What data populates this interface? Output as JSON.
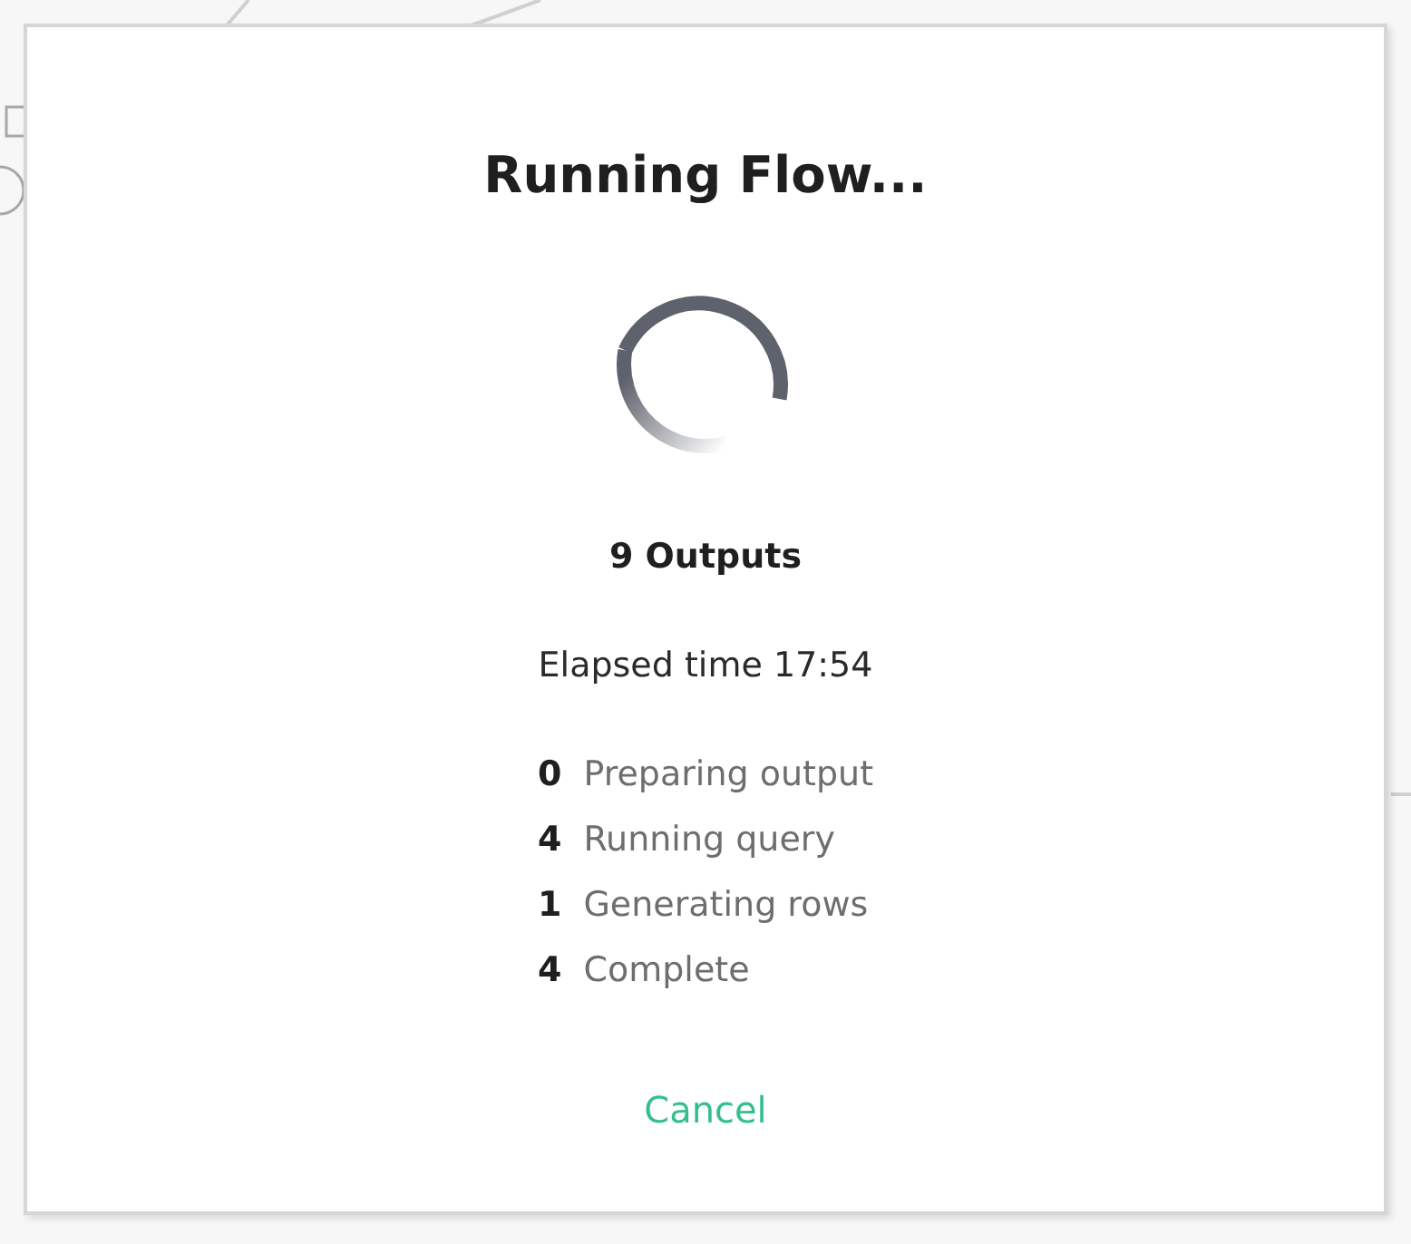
{
  "dialog": {
    "title": "Running Flow...",
    "outputs": "9 Outputs",
    "elapsed": "Elapsed time 17:54",
    "statuses": [
      {
        "count": "0",
        "label": "Preparing output"
      },
      {
        "count": "4",
        "label": "Running query"
      },
      {
        "count": "1",
        "label": "Generating rows"
      },
      {
        "count": "4",
        "label": "Complete"
      }
    ],
    "cancel_button": "Cancel"
  }
}
